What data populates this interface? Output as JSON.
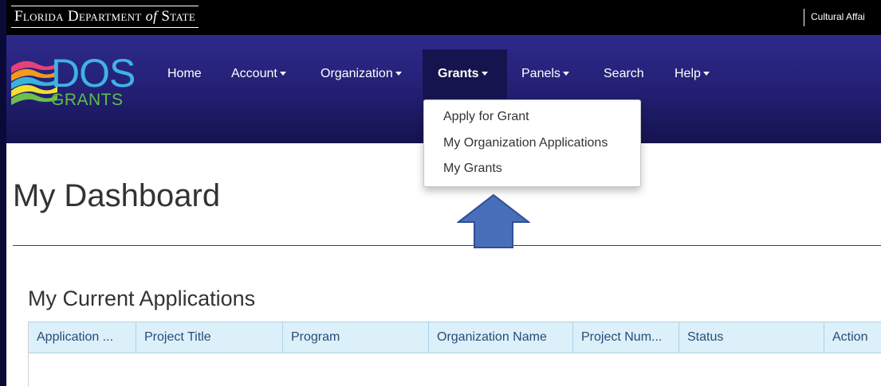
{
  "topbar": {
    "logo": {
      "part1": "Florida Department",
      "part2": "of",
      "part3": "State"
    },
    "link": "Cultural Affai"
  },
  "brand": {
    "title": "DOS",
    "subtitle": "GRANTS"
  },
  "nav": {
    "home": "Home",
    "account": "Account",
    "organization": "Organization",
    "grants": "Grants",
    "panels": "Panels",
    "search": "Search",
    "help": "Help"
  },
  "grants_menu": {
    "items": [
      "Apply for Grant",
      "My Organization Applications",
      "My Grants"
    ]
  },
  "page": {
    "title": "My Dashboard",
    "section_title": "My Current Applications"
  },
  "table": {
    "columns": [
      "Application ...",
      "Project Title",
      "Program",
      "Organization Name",
      "Project Num...",
      "Status",
      "Action"
    ]
  },
  "colors": {
    "navbar": "#221f72",
    "arrow": "#4a6fba",
    "table_header": "#dcf0f9"
  }
}
